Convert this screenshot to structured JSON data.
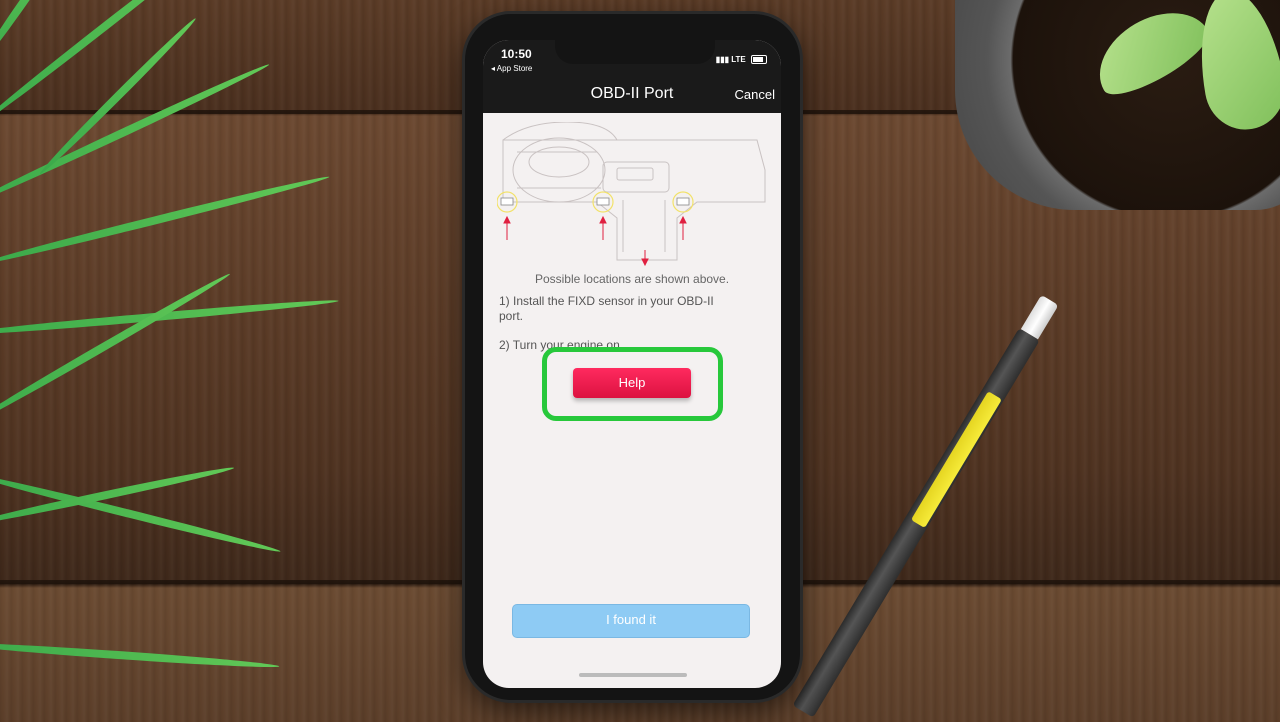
{
  "status_bar": {
    "time": "10:50",
    "back_label": "◂ App Store",
    "network": "LTE"
  },
  "nav": {
    "title": "OBD-II Port",
    "cancel_label": "Cancel"
  },
  "content": {
    "caption": "Possible locations are shown above.",
    "step1": "1) Install the FIXD sensor in your OBD-II port.",
    "step2": "2) Turn your engine on."
  },
  "buttons": {
    "help_label": "Help",
    "found_label": "I found it"
  },
  "colors": {
    "help_button": "#e8184b",
    "found_button": "#8ecbf4",
    "highlight": "#27c83b",
    "port_marker": "#f2e26a",
    "arrow": "#e02040"
  },
  "icons": [
    "signal-icon",
    "battery-icon",
    "obd-port-icon",
    "arrow-up-icon"
  ]
}
